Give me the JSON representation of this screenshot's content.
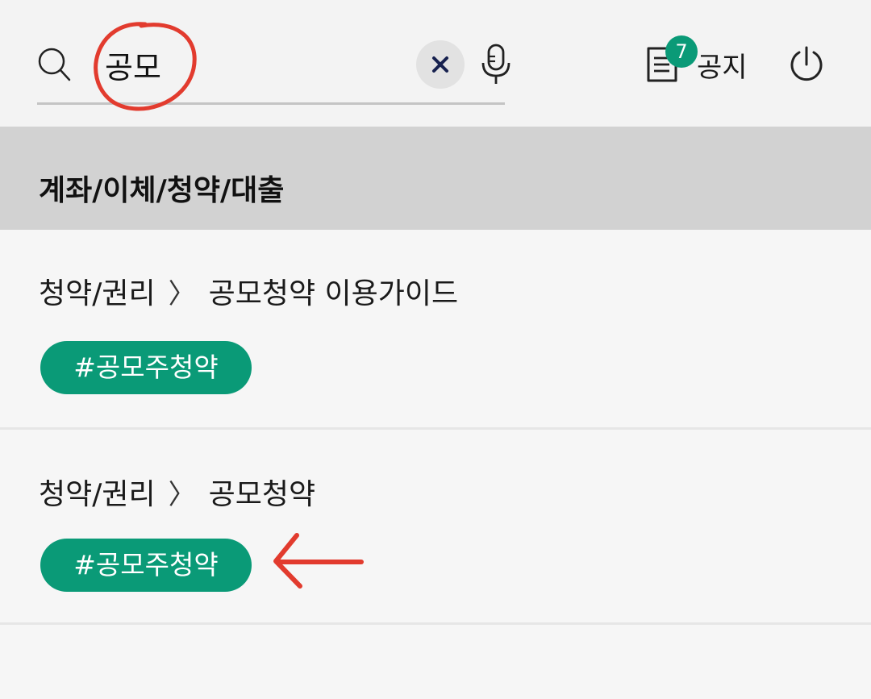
{
  "search": {
    "value": "공모",
    "placeholder": ""
  },
  "icons": {
    "search": "search-icon",
    "clear": "close-icon",
    "mic": "microphone-icon",
    "notice": "document-list-icon",
    "power": "power-icon"
  },
  "notice": {
    "badge_count": "7",
    "label": "공지"
  },
  "section": {
    "title": "계좌/이체/청약/대출"
  },
  "results": [
    {
      "category": "청약/권리",
      "page": "공모청약 이용가이드",
      "tag": "#공모주청약"
    },
    {
      "category": "청약/권리",
      "page": "공모청약",
      "tag": "#공모주청약"
    }
  ],
  "separator_glyph": "〉",
  "colors": {
    "accent": "#0a9a77",
    "annotation": "#e23b2e",
    "section_bg": "#d2d2d2"
  }
}
